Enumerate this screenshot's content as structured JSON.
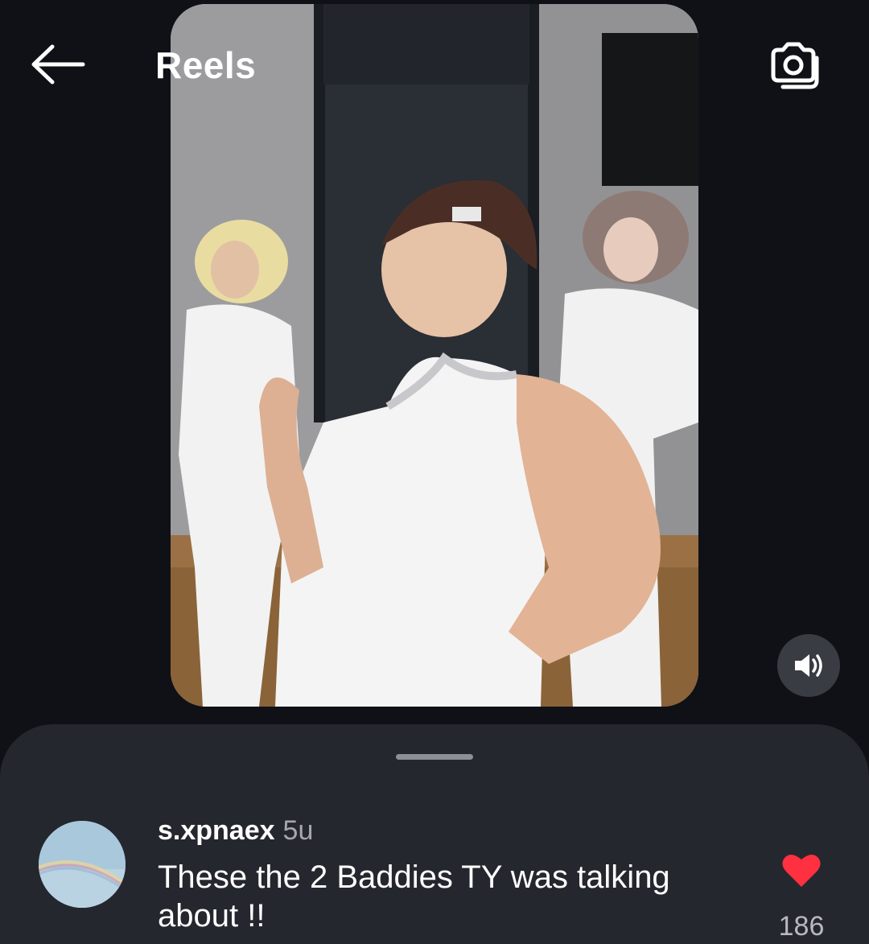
{
  "header": {
    "title": "Reels",
    "back_icon": "arrow-left-icon",
    "camera_icon": "camera-icon"
  },
  "video": {
    "volume_icon": "speaker-on-icon"
  },
  "comment": {
    "username": "s.xpnaex",
    "time": "5u",
    "text": "These the 2 Baddies TY was talking about !!",
    "like_count": "186",
    "like_icon": "heart-filled-icon",
    "like_color": "#ff3040"
  },
  "colors": {
    "background": "#0f1116",
    "sheet": "#25272e",
    "muted_text": "#a6a8ae"
  }
}
